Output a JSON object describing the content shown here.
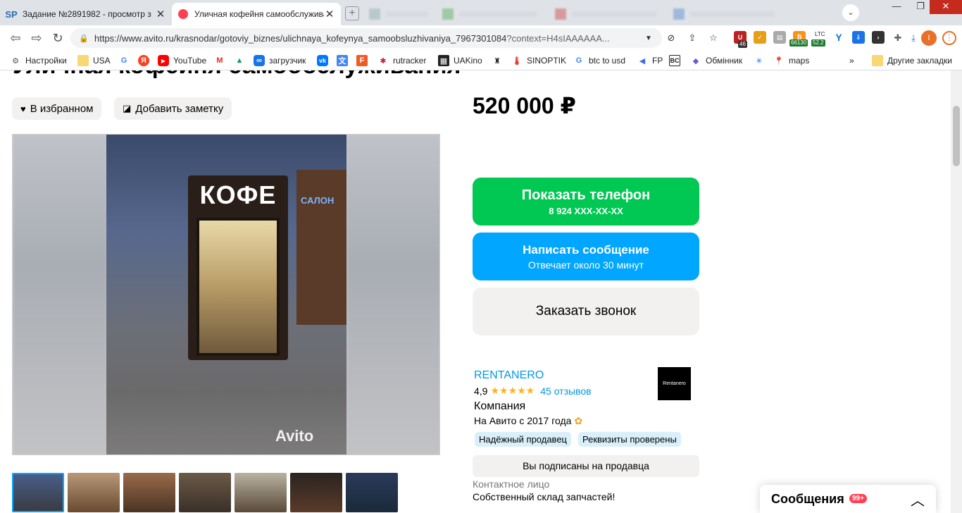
{
  "browser": {
    "tabs": [
      {
        "title": "Задание №2891982 - просмотр з",
        "favicon": "SP"
      },
      {
        "title": "Уличная кофейня самообслужива",
        "favicon": "avito-dot"
      },
      {
        "title": "",
        "favicon": ""
      },
      {
        "title": "",
        "favicon": ""
      },
      {
        "title": "",
        "favicon": ""
      },
      {
        "title": "",
        "favicon": ""
      }
    ],
    "window": {
      "minimize": "—",
      "restore": "❐",
      "close": "✕"
    },
    "url": {
      "main": "https://www.avito.ru/krasnodar/gotoviy_biznes/ulichnaya_kofeynya_samoobsluzhivaniya_7967301084",
      "rest": "?context=H4sIAAAAAA..."
    },
    "extension_badges": {
      "a": "46",
      "b": "66130",
      "c": "LTC",
      "d": "52.2"
    },
    "bookmarks": [
      {
        "label": "Настройки",
        "icon": "gear-icon"
      },
      {
        "label": "USA",
        "icon": "folder-icon"
      },
      {
        "label": "",
        "icon": "google-icon"
      },
      {
        "label": "",
        "icon": "yandex-icon"
      },
      {
        "label": "YouTube",
        "icon": "youtube-icon"
      },
      {
        "label": "",
        "icon": "gmail-icon"
      },
      {
        "label": "",
        "icon": "drive-icon"
      },
      {
        "label": "загрузчик",
        "icon": "loop-icon"
      },
      {
        "label": "",
        "icon": "vk-icon"
      },
      {
        "label": "",
        "icon": "translate-icon"
      },
      {
        "label": "",
        "icon": "f-icon"
      },
      {
        "label": "rutracker",
        "icon": "rutracker-icon"
      },
      {
        "label": "UAKino",
        "icon": "film-icon"
      },
      {
        "label": "",
        "icon": "figure-icon"
      },
      {
        "label": "SINOPTIK",
        "icon": "thermometer-icon"
      },
      {
        "label": "btc to usd",
        "icon": "google-icon"
      },
      {
        "label": "FP",
        "icon": "arrow-icon"
      },
      {
        "label": "",
        "icon": "bc-icon"
      },
      {
        "label": "Обмінник",
        "icon": "exchange-icon"
      },
      {
        "label": "",
        "icon": "star-burst-icon"
      },
      {
        "label": "maps",
        "icon": "maps-icon"
      }
    ],
    "overflow": "»",
    "other_bookmarks": "Другие закладки"
  },
  "listing": {
    "title": "Уличная кофейня самообслуживания",
    "favorite_label": "В избранном",
    "note_label": "Добавить заметку",
    "price": "520 000 ₽",
    "gallery": {
      "sign": "КОФЕ",
      "wall_sign": "САЛОН",
      "watermark": "Avito"
    },
    "thumbnail_count": 7
  },
  "actions": {
    "phone": {
      "label": "Показать телефон",
      "sub": "8 924 XXX-XX-XX"
    },
    "message": {
      "label": "Написать сообщение",
      "sub": "Отвечает около 30 минут"
    },
    "callback": {
      "label": "Заказать звонок"
    }
  },
  "seller": {
    "name": "RENTANERO",
    "rating": "4,9",
    "stars": "★★★★★",
    "reviews": "45 отзывов",
    "logo_text": "Rentanero",
    "type": "Компания",
    "since": "На Авито с 2017 года",
    "badges": [
      "Надёжный продавец",
      "Реквизиты проверены"
    ],
    "subscribed": "Вы подписаны на продавца",
    "contact_label": "Контактное лицо",
    "contact_name": "Собственный склад запчастей!"
  },
  "messages": {
    "title": "Сообщения",
    "count": "99+"
  },
  "colors": {
    "green": "#00c853",
    "blue": "#00a6ff",
    "link": "#0098e6",
    "star": "#ffb21e",
    "badge_bg": "#d9f0fb"
  }
}
